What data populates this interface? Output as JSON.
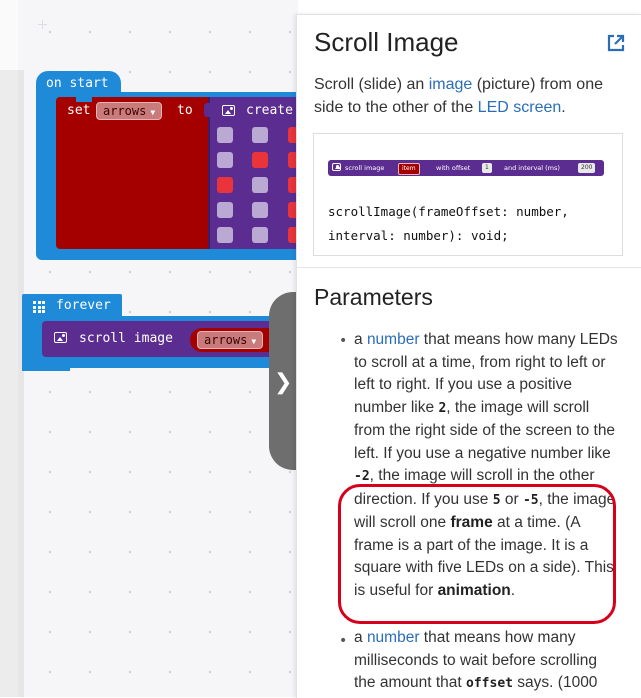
{
  "workspace": {
    "on_start": {
      "hat_label": "on start",
      "set_label": "set",
      "variable": "arrows",
      "to_label": "to",
      "create_label": "create",
      "led_rows": [
        [
          false,
          false,
          true
        ],
        [
          false,
          true,
          true
        ],
        [
          true,
          false,
          true
        ],
        [
          false,
          false,
          true
        ],
        [
          false,
          false,
          true
        ]
      ]
    },
    "forever": {
      "hat_label": "forever",
      "scroll_label": "scroll image",
      "variable": "arrows"
    },
    "collapse_icon": "chevron-right-icon"
  },
  "doc": {
    "title": "Scroll Image",
    "external_icon": "external-link-icon",
    "description": {
      "p1": "Scroll (slide) an ",
      "link1": "image",
      "p2": " (picture) from one side to the other of the ",
      "link2": "LED screen",
      "p3": "."
    },
    "signature": {
      "mini_block": {
        "label1": "scroll image",
        "var": "item",
        "label2": "with offset",
        "offset": "1",
        "label3": "and interval (ms)",
        "interval": "200"
      },
      "code_line1": "scrollImage(frameOffset: number,",
      "code_line2": "interval: number): void;"
    },
    "parameters_title": "Parameters",
    "param1": {
      "a": "a ",
      "link": "number",
      "t1": " that means how many LEDs to scroll at a time, from right to left or left to right. If you use a positive number like ",
      "c1": "2",
      "t2": ", the image will scroll from the right side of the screen to the left. If you use a negative number like ",
      "c2": "-2",
      "t3": ", the image will scroll in the other direction. If you use ",
      "c3": "5",
      "t4": " or ",
      "c4": "-5",
      "t5": ", the image will scroll one ",
      "b1": "frame",
      "t6": " at a time. (A frame is a part of the image. It is a square with five LEDs on a side). This is useful for ",
      "b2": "animation",
      "t7": "."
    },
    "param2": {
      "a": "a ",
      "link": "number",
      "t1": " that means how many milliseconds to wait before scrolling the amount that ",
      "c1": "offset",
      "t2": " says. (1000"
    }
  },
  "colors": {
    "event_blue": "#1f8ad8",
    "variable_red": "#a40000",
    "image_purple": "#5c2d91",
    "led_on": "#e8343a",
    "link_blue": "#2a6db8",
    "highlight_red": "#d6001c"
  }
}
